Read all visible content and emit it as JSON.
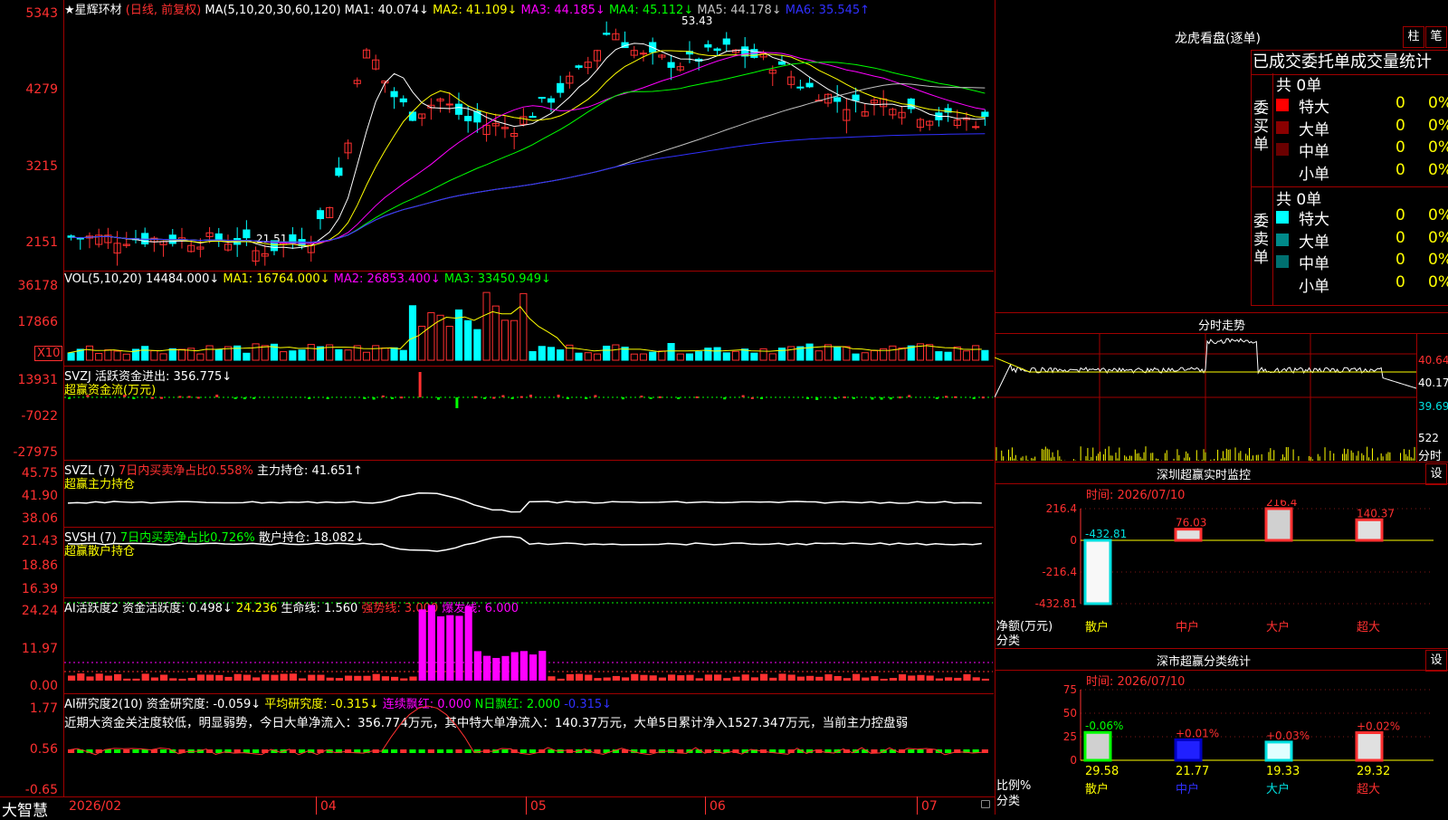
{
  "app": {
    "brand": "大智慧"
  },
  "main_chart": {
    "stock_name": "★星辉环材",
    "period": "(日线, 前复权)",
    "ma_params": "MA(5,10,20,30,60,120)",
    "ma1": "MA1: 40.074↓",
    "ma2": "MA2: 41.109↓",
    "ma3": "MA3: 44.185↓",
    "ma4": "MA4: 45.112↓",
    "ma5": "MA5: 44.178↓",
    "ma6": "MA6: 35.545↑",
    "high_label": "53.43",
    "low_label": "21.51",
    "y_ticks": [
      "5343",
      "4279",
      "3215",
      "2151"
    ],
    "colors": {
      "up": "#ff3030",
      "down": "#00ffff",
      "ma1": "#ffffff",
      "ma2": "#ffff00",
      "ma3": "#ff00ff",
      "ma4": "#00ff00",
      "ma5": "#c0c0c0",
      "ma6": "#3030ff"
    }
  },
  "vol": {
    "params": "VOL(5,10,20)",
    "value": "14484.000↓",
    "ma1": "MA1: 16764.000↓",
    "ma2": "MA2: 26853.400↓",
    "ma3": "MA3: 33450.949↓",
    "y_ticks": [
      "36178",
      "17866"
    ],
    "unit": "X10"
  },
  "svzj": {
    "header": "SVZJ  活跃资金进出: 356.775↓",
    "subtitle": "超赢资金流(万元)",
    "y_ticks": [
      "13931",
      "-7022",
      "-27975"
    ]
  },
  "svzl": {
    "name": "SVZL (7)",
    "ratio": "7日内买卖净占比0.558%",
    "hold": "主力持仓: 41.651↑",
    "subtitle": "超赢主力持仓",
    "y_ticks": [
      "45.75",
      "41.90",
      "38.06"
    ]
  },
  "svsh": {
    "name": "SVSH (7)",
    "ratio": "7日内买卖净占比0.726%",
    "hold": "散户持仓: 18.082↓",
    "subtitle": "超赢散户持仓",
    "y_ticks": [
      "21.43",
      "18.86",
      "16.39"
    ]
  },
  "ai_active": {
    "name": "AI活跃度2",
    "v1": "资金活跃度: 0.498↓",
    "v2": "24.236",
    "v3": "生命线: 1.560",
    "v4": "强势线: 3.000",
    "v5": "爆发线: 6.000",
    "y_ticks": [
      "24.24",
      "11.97",
      "0.00"
    ]
  },
  "ai_research": {
    "name": "AI研究度2(10)",
    "v1": "资金研究度: -0.059↓",
    "v2": "平均研究度: -0.315↓",
    "v3": "连续飘红: 0.000",
    "v4": "N日飘红: 2.000",
    "v5": "-0.315↓",
    "comment": "近期大资金关注度较低，明显弱势，今日大单净流入：356.774万元，其中特大单净流入：140.37万元，大单5日累计净入1527.347万元，当前主力控盘弱",
    "y_ticks": [
      "1.77",
      "0.56",
      "-0.65"
    ]
  },
  "x_axis": {
    "labels": [
      "2026/02",
      "04",
      "05",
      "06",
      "07"
    ]
  },
  "longhu": {
    "title": "龙虎看盘(逐单)",
    "btn1": "柱",
    "btn2": "笔",
    "heading": "已成交委托单成交量统计",
    "buy": {
      "side_label": "委买单",
      "total": "共 0单",
      "rows": [
        {
          "label": "特大",
          "count": "0",
          "pct": "0%"
        },
        {
          "label": "大单",
          "count": "0",
          "pct": "0%"
        },
        {
          "label": "中单",
          "count": "0",
          "pct": "0%"
        },
        {
          "label": "小单",
          "count": "0",
          "pct": "0%"
        }
      ]
    },
    "sell": {
      "side_label": "委卖单",
      "total": "共 0单",
      "rows": [
        {
          "label": "特大",
          "count": "0",
          "pct": "0%"
        },
        {
          "label": "大单",
          "count": "0",
          "pct": "0%"
        },
        {
          "label": "中单",
          "count": "0",
          "pct": "0%"
        },
        {
          "label": "小单",
          "count": "0",
          "pct": "0%"
        }
      ]
    }
  },
  "intraday": {
    "title": "分时走势",
    "price_ticks": [
      "40.64",
      "40.17",
      "39.69"
    ],
    "vol_tick": "522",
    "unit": "分时"
  },
  "monitor": {
    "title": "深圳超赢实时监控",
    "btn": "设",
    "time": "时间: 2026/07/10",
    "y_ticks": [
      "216.4",
      "0",
      "-216.4",
      "-432.81"
    ],
    "ylabel": "净额(万元)",
    "xlabel": "分类",
    "categories": [
      "散户",
      "中户",
      "大户",
      "超大"
    ],
    "values": [
      -432.81,
      76.03,
      216.4,
      140.37
    ],
    "value_labels": [
      "-432.81",
      "76.03",
      "216.4",
      "140.37"
    ]
  },
  "classify": {
    "title": "深市超赢分类统计",
    "btn": "设",
    "time": "时间: 2026/07/10",
    "y_ticks": [
      "75",
      "50",
      "25",
      "0"
    ],
    "ylabel": "比例%",
    "xlabel": "分类",
    "categories": [
      "散户",
      "中户",
      "大户",
      "超大"
    ],
    "values": [
      29.58,
      21.77,
      19.33,
      29.32
    ],
    "value_labels": [
      "29.58",
      "21.77",
      "19.33",
      "29.32"
    ],
    "change_labels": [
      "-0.06%",
      "+0.01%",
      "+0.03%",
      "+0.02%"
    ]
  },
  "chart_data": [
    {
      "type": "bar",
      "title": "深圳超赢实时监控",
      "categories": [
        "散户",
        "中户",
        "大户",
        "超大"
      ],
      "values": [
        -432.81,
        76.03,
        216.4,
        140.37
      ],
      "ylabel": "净额(万元)",
      "ylim": [
        -432.81,
        216.4
      ]
    },
    {
      "type": "bar",
      "title": "深市超赢分类统计",
      "categories": [
        "散户",
        "中户",
        "大户",
        "超大"
      ],
      "values": [
        29.58,
        21.77,
        19.33,
        29.32
      ],
      "ylabel": "比例%",
      "ylim": [
        0,
        75
      ]
    }
  ]
}
